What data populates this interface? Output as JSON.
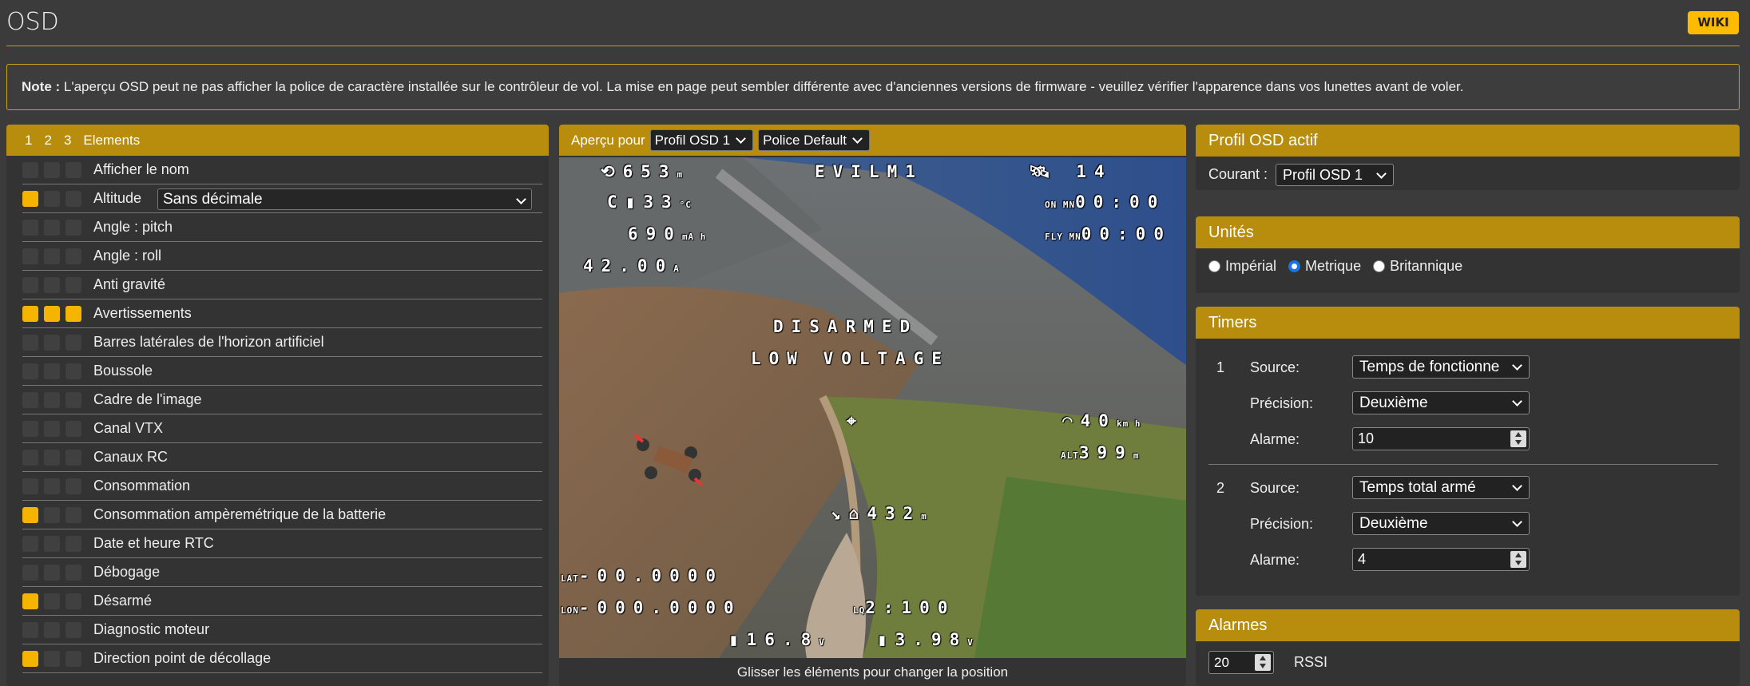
{
  "page": {
    "title": "OSD",
    "wiki_label": "WIKI"
  },
  "note": {
    "label": "Note :",
    "text": " L'aperçu OSD peut ne pas afficher la police de caractère installée sur le contrôleur de vol. La mise en page peut sembler différente avec d'anciennes versions de firmware - veuillez vérifier l'apparence dans vos lunettes avant de voler."
  },
  "elements": {
    "header": {
      "p1": "1",
      "p2": "2",
      "p3": "3",
      "label": "Elements"
    },
    "items": [
      {
        "label": "Afficher le nom",
        "checks": [
          false,
          false,
          false
        ]
      },
      {
        "label": "Altitude",
        "checks": [
          true,
          false,
          false
        ],
        "select": "Sans décimale"
      },
      {
        "label": "Angle : pitch",
        "checks": [
          false,
          false,
          false
        ]
      },
      {
        "label": "Angle : roll",
        "checks": [
          false,
          false,
          false
        ]
      },
      {
        "label": "Anti gravité",
        "checks": [
          false,
          false,
          false
        ]
      },
      {
        "label": "Avertissements",
        "checks": [
          true,
          true,
          true
        ]
      },
      {
        "label": "Barres latérales de l'horizon artificiel",
        "checks": [
          false,
          false,
          false
        ]
      },
      {
        "label": "Boussole",
        "checks": [
          false,
          false,
          false
        ]
      },
      {
        "label": "Cadre de l'image",
        "checks": [
          false,
          false,
          false
        ]
      },
      {
        "label": "Canal VTX",
        "checks": [
          false,
          false,
          false
        ]
      },
      {
        "label": "Canaux RC",
        "checks": [
          false,
          false,
          false
        ]
      },
      {
        "label": "Consommation",
        "checks": [
          false,
          false,
          false
        ]
      },
      {
        "label": "Consommation ampèremétrique de la batterie",
        "checks": [
          true,
          false,
          false
        ]
      },
      {
        "label": "Date et heure RTC",
        "checks": [
          false,
          false,
          false
        ]
      },
      {
        "label": "Débogage",
        "checks": [
          false,
          false,
          false
        ]
      },
      {
        "label": "Désarmé",
        "checks": [
          true,
          false,
          false
        ]
      },
      {
        "label": "Diagnostic moteur",
        "checks": [
          false,
          false,
          false
        ]
      },
      {
        "label": "Direction point de décollage",
        "checks": [
          true,
          false,
          false
        ]
      }
    ]
  },
  "preview": {
    "label": "Aperçu pour",
    "profile_select": "Profil OSD 1",
    "font_select": "Police Default",
    "drag_hint": "Glisser les éléments pour changer la position",
    "osd": {
      "alt": "653",
      "alt_unit": "m",
      "temp": "33",
      "temp_unit": "°C",
      "mah": "690",
      "mah_unit": "mA h",
      "amps": "42.00",
      "amps_unit": "A",
      "craft_name": "EVILM1",
      "sats": "14",
      "on_time": "00:00",
      "on_label": "ON MN",
      "fly_time": "00:00",
      "fly_label": "FLY MN",
      "warn1": "DISARMED",
      "warn2": "LOW VOLTAGE",
      "speed": "40",
      "speed_unit": "km h",
      "altitude_label": "ALT",
      "altitude2": "399",
      "altitude2_unit": "m",
      "home_dist": "432",
      "home_dist_unit": "m",
      "lat_label": "LAT",
      "lat": "-00.0000",
      "lon_label": "LON",
      "lon": "-000.0000",
      "link": "2:100",
      "batt": "16.8",
      "batt_unit": "V",
      "cell": "3.98",
      "cell_unit": "V"
    }
  },
  "profile": {
    "title": "Profil OSD actif",
    "current_label": "Courant :",
    "current_value": "Profil OSD 1"
  },
  "units": {
    "title": "Unités",
    "options": [
      {
        "label": "Impérial",
        "selected": false
      },
      {
        "label": "Metrique",
        "selected": true
      },
      {
        "label": "Britannique",
        "selected": false
      }
    ]
  },
  "timers": {
    "title": "Timers",
    "source_label": "Source:",
    "precision_label": "Précision:",
    "alarm_label": "Alarme:",
    "items": [
      {
        "index": "1",
        "source": "Temps de fonctionne",
        "precision": "Deuxième",
        "alarm": "10"
      },
      {
        "index": "2",
        "source": "Temps total armé",
        "precision": "Deuxième",
        "alarm": "4"
      }
    ]
  },
  "alarms": {
    "title": "Alarmes",
    "rssi_value": "20",
    "rssi_label": "RSSI"
  },
  "colors": {
    "accent": "#ffbb00",
    "panel_header": "#b88c0c",
    "background": "#3b3b3b"
  }
}
